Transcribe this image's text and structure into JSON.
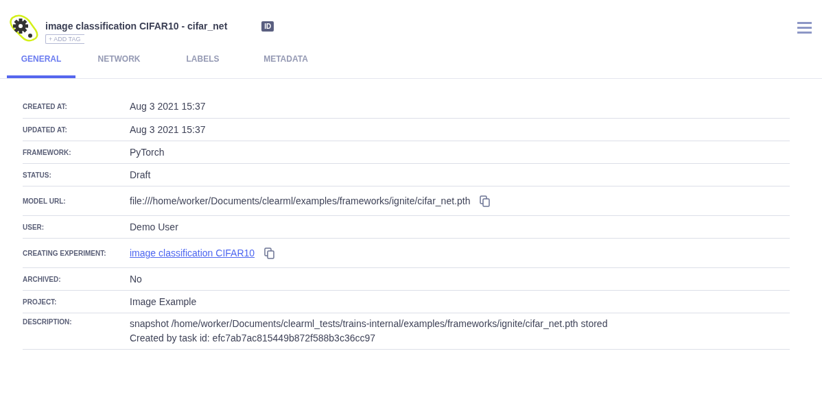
{
  "header": {
    "title": "image classification CIFAR10 - cifar_net",
    "id_badge": "ID",
    "add_tag": "+ ADD TAG"
  },
  "tabs": [
    {
      "label": "GENERAL",
      "selected": true
    },
    {
      "label": "NETWORK",
      "selected": false
    },
    {
      "label": "LABELS",
      "selected": false
    },
    {
      "label": "METADATA",
      "selected": false
    }
  ],
  "details": [
    {
      "label": "CREATED AT:",
      "kind": "text",
      "lines": [
        "Aug 3 2021 15:37"
      ]
    },
    {
      "label": "UPDATED AT:",
      "kind": "text",
      "lines": [
        "Aug 3 2021 15:37"
      ]
    },
    {
      "label": "FRAMEWORK:",
      "kind": "text",
      "lines": [
        "PyTorch"
      ]
    },
    {
      "label": "STATUS:",
      "kind": "text",
      "lines": [
        "Draft"
      ]
    },
    {
      "label": "MODEL URL:",
      "kind": "copy",
      "lines": [
        "file:///home/worker/Documents/clearml/examples/frameworks/ignite/cifar_net.pth"
      ]
    },
    {
      "label": "USER:",
      "kind": "text",
      "lines": [
        "Demo User"
      ]
    },
    {
      "label": "CREATING EXPERIMENT:",
      "kind": "link",
      "lines": [
        "image classification CIFAR10 "
      ]
    },
    {
      "label": "ARCHIVED:",
      "kind": "text",
      "lines": [
        "No"
      ]
    },
    {
      "label": "PROJECT:",
      "kind": "text",
      "lines": [
        "Image Example"
      ]
    },
    {
      "label": "DESCRIPTION:",
      "kind": "text",
      "lines": [
        "snapshot /home/worker/Documents/clearml_tests/trains-internal/examples/frameworks/ignite/cifar_net.pth stored",
        "Created by task id: efc7ab7ac815449b872f588b3c36cc97"
      ]
    }
  ]
}
